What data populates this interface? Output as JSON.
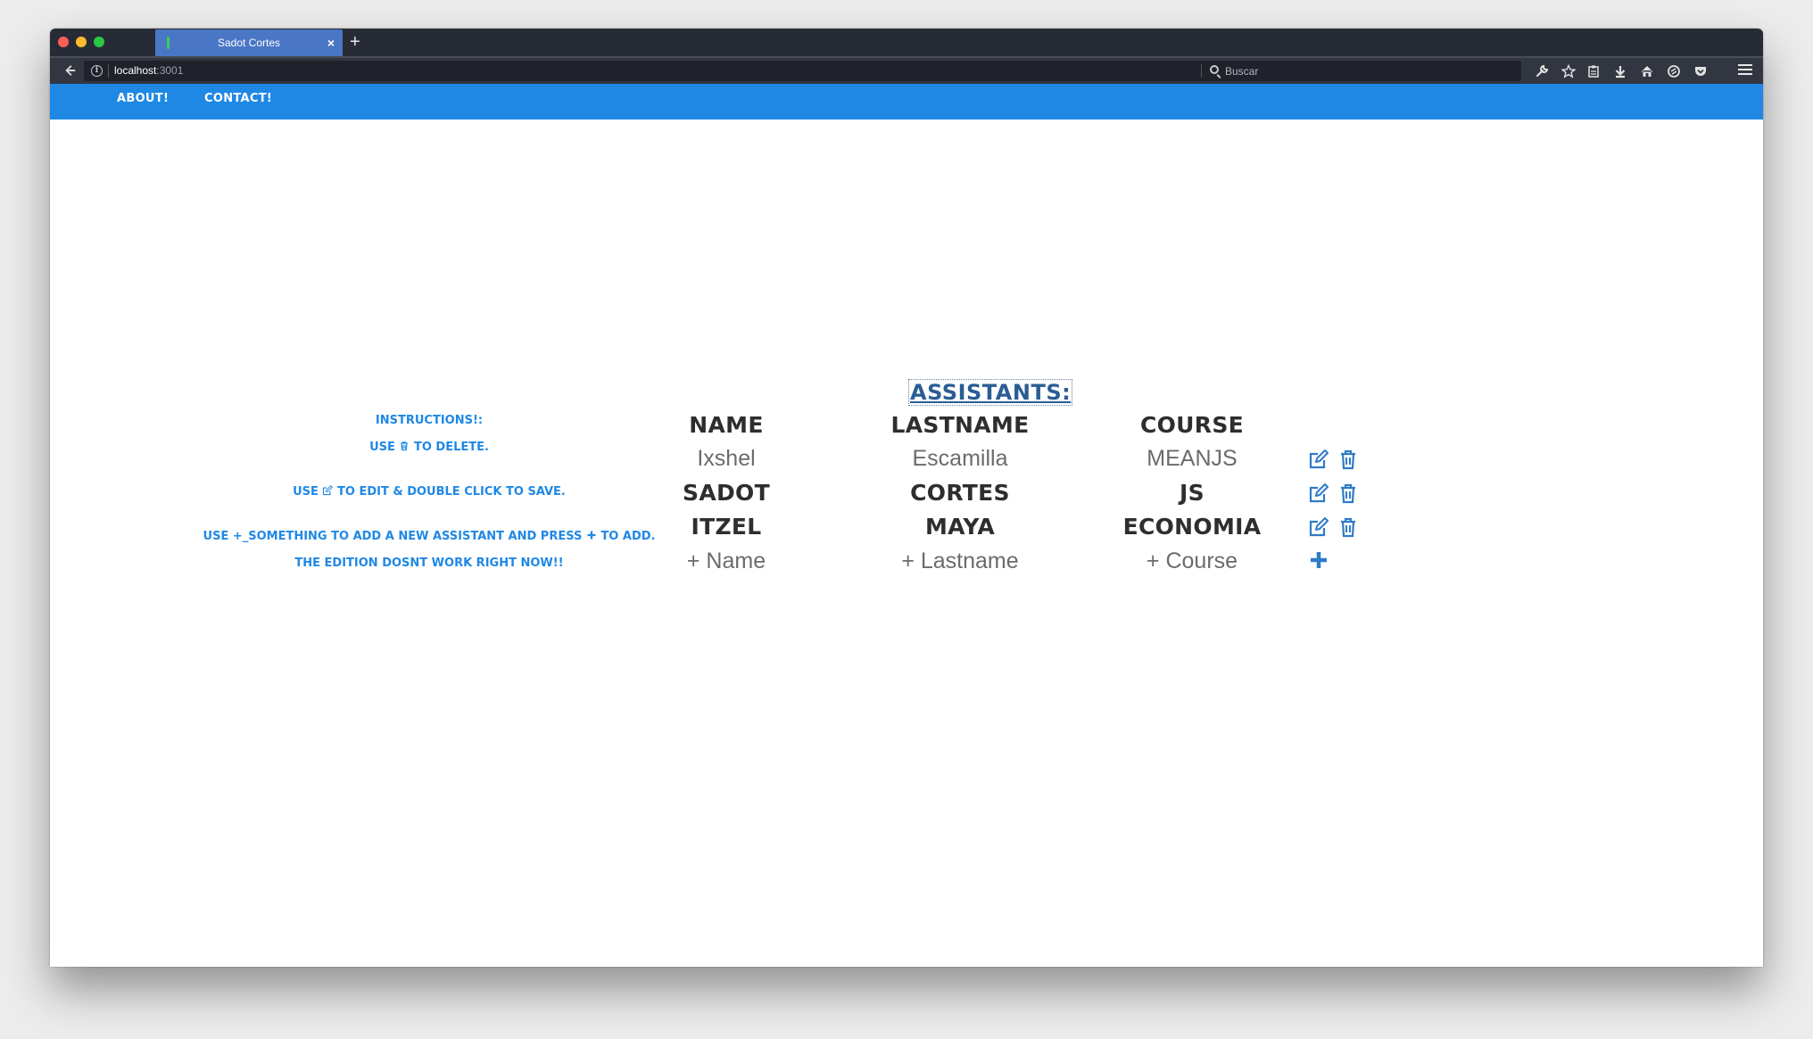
{
  "browser": {
    "tab_title": "Sadot Cortes",
    "tab_close": "×",
    "new_tab": "+",
    "url_host": "localhost",
    "url_port": ":3001",
    "search_placeholder": "Buscar"
  },
  "nav": {
    "about": "About!",
    "contact": "Contact!"
  },
  "instructions": {
    "title": "Instructions!:",
    "delete_pre": "Use",
    "delete_post": "to delete.",
    "edit_pre": "Use",
    "edit_post": "to edit & double click to save.",
    "add_pre": "Use +_something to add a new assistant and press",
    "add_post": "to add.",
    "edition_note": "The edition dosnt work right now!!"
  },
  "table": {
    "title": "Assistants:",
    "headers": {
      "name": "Name",
      "lastname": "Lastname",
      "course": "Course"
    },
    "rows": [
      {
        "name": "Ixshel",
        "lastname": "Escamilla",
        "course": "MEANJS"
      },
      {
        "name": "Sadot",
        "lastname": "Cortes",
        "course": "JS"
      },
      {
        "name": "Itzel",
        "lastname": "Maya",
        "course": "Economia"
      }
    ],
    "add_row": {
      "name_placeholder": "+ Name",
      "lastname_placeholder": "+ Lastname",
      "course_placeholder": "+ Course"
    }
  },
  "colors": {
    "accent": "#1f88e5",
    "title": "#2a5d94",
    "icon": "#2f7bc8"
  },
  "icons": {
    "edit": "edit-icon",
    "delete": "trash-icon",
    "add": "plus-icon"
  }
}
